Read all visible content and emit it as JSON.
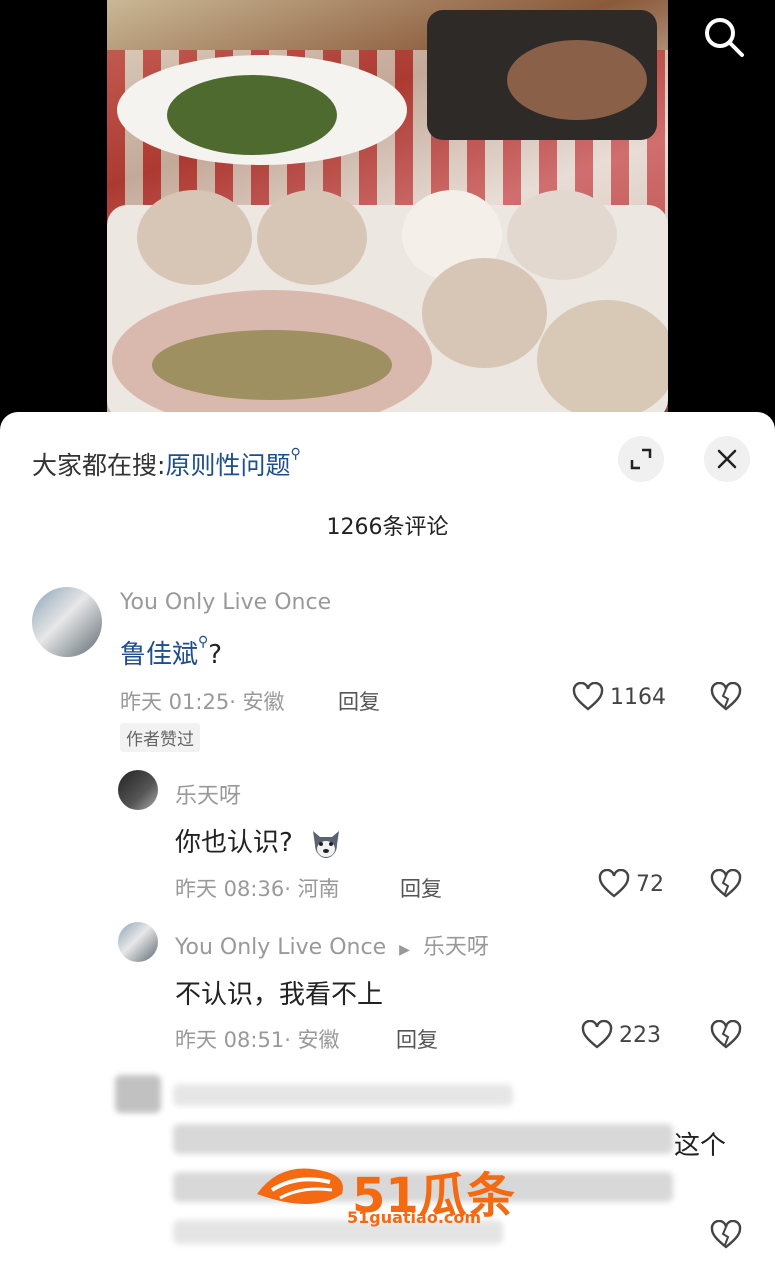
{
  "header": {
    "hot_search_prefix": "大家都在搜:",
    "hot_search_keyword": "原则性问题",
    "comment_count": "1266条评论"
  },
  "comments": [
    {
      "user": "You Only Live Once",
      "text_keyword": "鲁佳斌",
      "text_tail": "?",
      "time": "昨天 01:25",
      "location": "· 安徽",
      "reply_label": "回复",
      "likes": "1164",
      "badge": "作者赞过"
    },
    {
      "user": "乐天呀",
      "text": "你也认识?",
      "time": "昨天 08:36",
      "location": "· 河南",
      "reply_label": "回复",
      "likes": "72"
    },
    {
      "user": "You Only Live Once",
      "reply_to": "乐天呀",
      "text": "不认识，我看不上",
      "time": "昨天 08:51",
      "location": "· 安徽",
      "reply_label": "回复",
      "likes": "223"
    }
  ],
  "partial_text": "这个",
  "watermark": {
    "title": "51瓜条",
    "subtitle": "51guatiao.com"
  }
}
